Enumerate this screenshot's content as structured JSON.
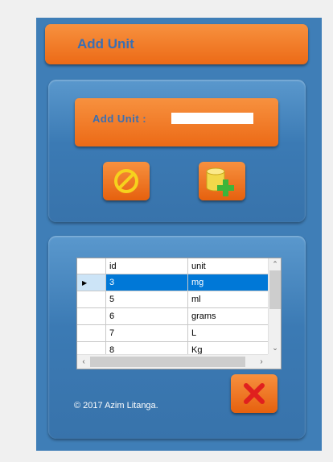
{
  "header": {
    "title": "Add Unit"
  },
  "form": {
    "label": "Add Unit :",
    "value": ""
  },
  "buttons": {
    "cancel_icon": "cancel-icon",
    "add_icon": "database-add-icon",
    "close_icon": "close-x-icon"
  },
  "grid": {
    "columns": [
      "id",
      "unit"
    ],
    "rows": [
      {
        "id": "3",
        "unit": "mg"
      },
      {
        "id": "5",
        "unit": "ml"
      },
      {
        "id": "6",
        "unit": "grams"
      },
      {
        "id": "7",
        "unit": "L"
      },
      {
        "id": "8",
        "unit": "Kg"
      }
    ],
    "selected_row": 0
  },
  "footer": {
    "copyright": "© 2017 Azim Litanga."
  },
  "colors": {
    "window": "#3f7eb7",
    "orange": "#ec6a16",
    "title_text": "#3a6fb3",
    "selection": "#0078d7"
  }
}
